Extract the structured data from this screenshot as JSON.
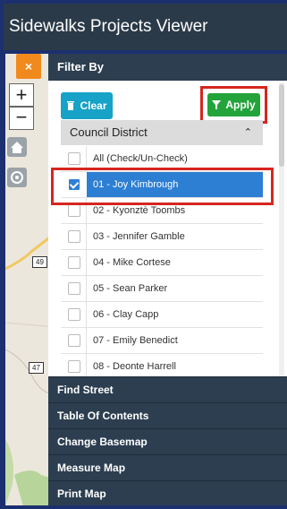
{
  "app": {
    "title": "Sidewalks Projects Viewer"
  },
  "map": {
    "close_label": "×",
    "zoom_in_label": "+",
    "zoom_out_label": "−",
    "road_shields": [
      "49",
      "47"
    ]
  },
  "filter": {
    "title": "Filter By",
    "clear_label": "Clear",
    "apply_label": "Apply",
    "group_label": "Council District",
    "items": [
      {
        "label": "All (Check/Un-Check)",
        "checked": false,
        "selected": false
      },
      {
        "label": "01 - Joy Kimbrough",
        "checked": true,
        "selected": true
      },
      {
        "label": "02 - Kyonztè Toombs",
        "checked": false,
        "selected": false
      },
      {
        "label": "03 - Jennifer Gamble",
        "checked": false,
        "selected": false
      },
      {
        "label": "04 - Mike Cortese",
        "checked": false,
        "selected": false
      },
      {
        "label": "05 - Sean Parker",
        "checked": false,
        "selected": false
      },
      {
        "label": "06 - Clay Capp",
        "checked": false,
        "selected": false
      },
      {
        "label": "07 - Emily Benedict",
        "checked": false,
        "selected": false
      },
      {
        "label": "08 - Deonte Harrell",
        "checked": false,
        "selected": false
      }
    ]
  },
  "accordion": {
    "items": [
      "Find Street",
      "Table Of Contents",
      "Change Basemap",
      "Measure Map",
      "Print Map"
    ]
  },
  "colors": {
    "header": "#2b3a48",
    "panel_header": "#2c3e50",
    "clear": "#17a2c7",
    "apply": "#23a43a",
    "selected_row": "#2d7fd3",
    "highlight": "#d7261f"
  },
  "icons": {
    "clear": "trash-icon",
    "apply": "filter-icon",
    "collapse": "chevron-up-icon",
    "home": "home-icon",
    "locate": "locate-icon"
  }
}
